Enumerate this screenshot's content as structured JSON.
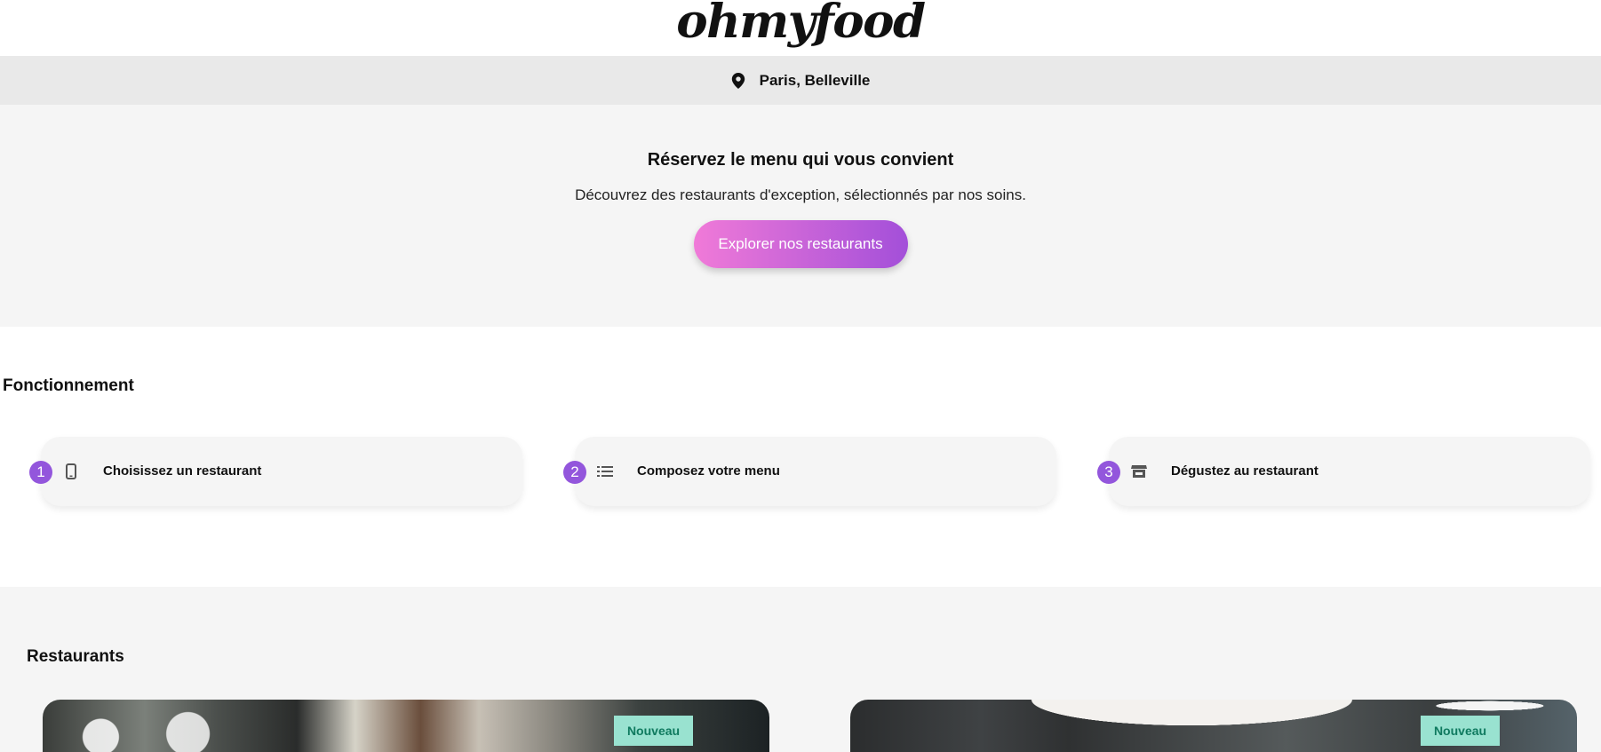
{
  "header": {
    "logo_text": "ohmyfood"
  },
  "location": {
    "icon": "map-pin-icon",
    "text": "Paris, Belleville"
  },
  "hero": {
    "title": "Réservez le menu qui vous convient",
    "subtitle": "Découvrez des restaurants d'exception, sélectionnés par nos soins.",
    "cta_label": "Explorer nos restaurants"
  },
  "how": {
    "title": "Fonctionnement",
    "steps": [
      {
        "number": "1",
        "icon": "mobile-phone-icon",
        "label": "Choisissez un restaurant"
      },
      {
        "number": "2",
        "icon": "list-icon",
        "label": "Composez votre menu"
      },
      {
        "number": "3",
        "icon": "store-icon",
        "label": "Dégustez au restaurant"
      }
    ]
  },
  "restaurants": {
    "title": "Restaurants",
    "cards": [
      {
        "badge": "Nouveau"
      },
      {
        "badge": "Nouveau"
      }
    ]
  },
  "colors": {
    "accent_purple": "#9356dc",
    "gradient_start": "#f07ad8",
    "gradient_end": "#a34fd9",
    "badge_bg": "#99e2d0",
    "badge_text": "#0f7a5f"
  }
}
